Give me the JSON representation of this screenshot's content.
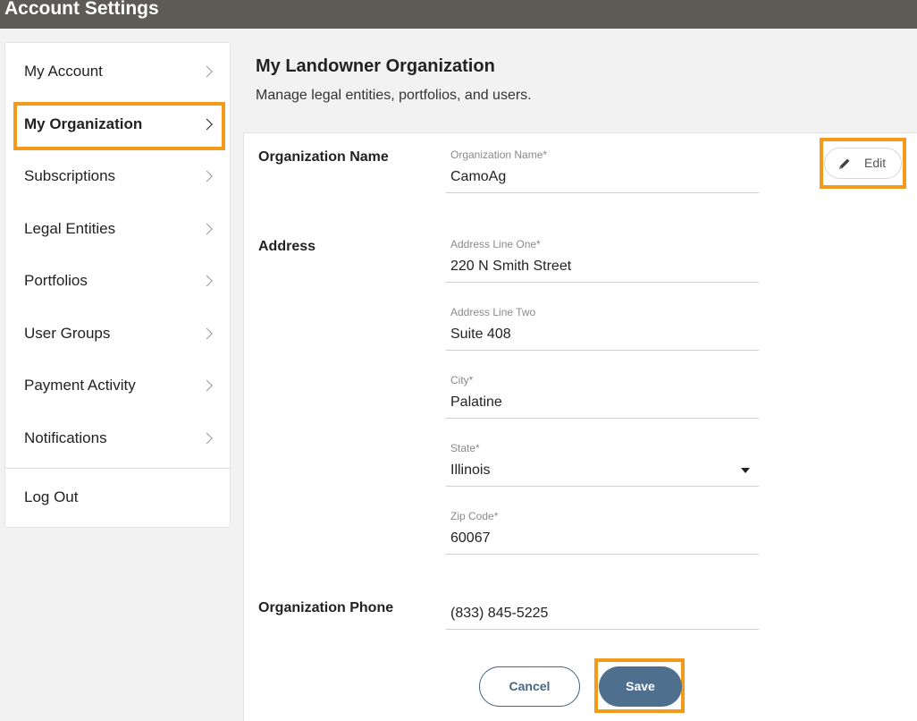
{
  "header": {
    "title": "Account Settings"
  },
  "sidebar": {
    "items": [
      {
        "label": "My Account"
      },
      {
        "label": "My Organization"
      },
      {
        "label": "Subscriptions"
      },
      {
        "label": "Legal Entities"
      },
      {
        "label": "Portfolios"
      },
      {
        "label": "User Groups"
      },
      {
        "label": "Payment Activity"
      },
      {
        "label": "Notifications"
      }
    ],
    "logout": "Log Out"
  },
  "page": {
    "title": "My Landowner Organization",
    "subtitle": "Manage legal entities, portfolios, and users."
  },
  "sections": {
    "org_name": "Organization Name",
    "address": "Address",
    "phone": "Organization Phone"
  },
  "fields": {
    "org_name": {
      "label": "Organization Name*",
      "value": "CamoAg"
    },
    "address1": {
      "label": "Address Line One*",
      "value": "220 N Smith Street"
    },
    "address2": {
      "label": "Address Line Two",
      "value": "Suite 408"
    },
    "city": {
      "label": "City*",
      "value": "Palatine"
    },
    "state": {
      "label": "State*",
      "value": "Illinois"
    },
    "zip": {
      "label": "Zip Code*",
      "value": "60067"
    },
    "phone": {
      "value": "(833) 845-5225"
    }
  },
  "buttons": {
    "edit": "Edit",
    "cancel": "Cancel",
    "save": "Save"
  },
  "icons": {
    "chevron": "chevron-right-icon",
    "edit": "pencil-icon",
    "dropdown": "caret-down-icon"
  },
  "colors": {
    "header_bg": "#5e5a55",
    "highlight": "#f39a1a",
    "primary": "#4f6f8f"
  }
}
